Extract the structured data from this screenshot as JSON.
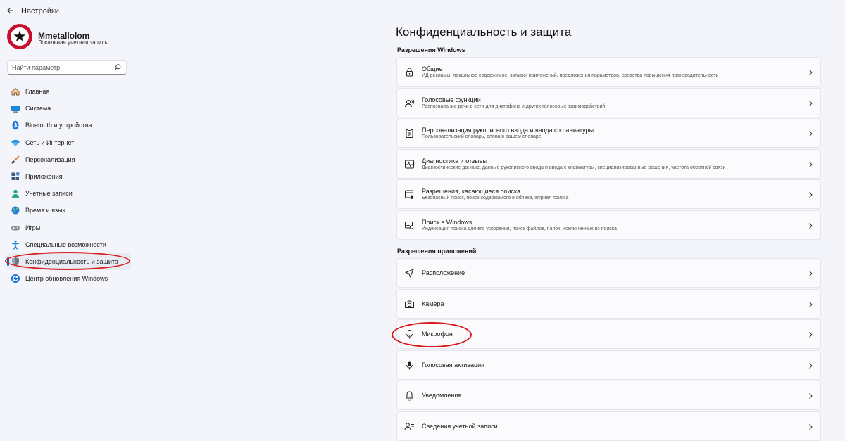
{
  "window": {
    "title": "Настройки",
    "back_icon": "back-arrow-icon"
  },
  "profile": {
    "name": "Mmetallolom",
    "account_type": "Локальная учетная запись"
  },
  "search": {
    "placeholder": "Найти параметр"
  },
  "sidebar": {
    "items": [
      {
        "label": "Главная",
        "icon": "home-icon"
      },
      {
        "label": "Система",
        "icon": "system-icon"
      },
      {
        "label": "Bluetooth и устройства",
        "icon": "bluetooth-icon"
      },
      {
        "label": "Сеть и Интернет",
        "icon": "network-icon"
      },
      {
        "label": "Персонализация",
        "icon": "brush-icon"
      },
      {
        "label": "Приложения",
        "icon": "apps-icon"
      },
      {
        "label": "Учетные записи",
        "icon": "accounts-icon"
      },
      {
        "label": "Время и язык",
        "icon": "globe-icon"
      },
      {
        "label": "Игры",
        "icon": "gamepad-icon"
      },
      {
        "label": "Специальные возможности",
        "icon": "accessibility-icon"
      },
      {
        "label": "Конфиденциальность и защита",
        "icon": "shield-icon",
        "selected": true
      },
      {
        "label": "Центр обновления Windows",
        "icon": "update-icon"
      }
    ]
  },
  "main": {
    "title": "Конфиденциальность и защита",
    "sections": [
      {
        "title": "Разрешения Windows",
        "items": [
          {
            "title": "Общие",
            "description": "ИД рекламы, локальное содержимое, запуски приложений, предложения параметров, средства повышения производительности",
            "icon": "lock-icon"
          },
          {
            "title": "Голосовые функции",
            "description": "Распознавание речи в сети для диктофона и других голосовых взаимодействий",
            "icon": "speech-icon"
          },
          {
            "title": "Персонализация рукописного ввода и ввода с клавиатуры",
            "description": "Пользовательский словарь, слова в вашем словаре",
            "icon": "clipboard-icon"
          },
          {
            "title": "Диагностика и отзывы",
            "description": "Диагностические данные, данные рукописного ввода и ввода с клавиатуры, специализированные решения, частота обратной связи",
            "icon": "diagnostics-icon"
          },
          {
            "title": "Разрешения, касающиеся поиска",
            "description": "Безопасный поиск, поиск содержимого в облаке, журнал поиска",
            "icon": "search-permissions-icon"
          },
          {
            "title": "Поиск в Windows",
            "description": "Индексация поиска для его ускорения, поиск файлов, папок, исключенных из поиска",
            "icon": "windows-search-icon"
          }
        ]
      },
      {
        "title": "Разрешения приложений",
        "items": [
          {
            "title": "Расположение",
            "icon": "location-icon"
          },
          {
            "title": "Камера",
            "icon": "camera-icon"
          },
          {
            "title": "Микрофон",
            "icon": "microphone-icon"
          },
          {
            "title": "Голосовая активация",
            "icon": "voice-activation-icon"
          },
          {
            "title": "Уведомления",
            "icon": "bell-icon"
          },
          {
            "title": "Сведения учетной записи",
            "icon": "account-info-icon"
          }
        ]
      }
    ]
  },
  "annotation_color": "#d9191c",
  "accent_color": "#0067c0"
}
